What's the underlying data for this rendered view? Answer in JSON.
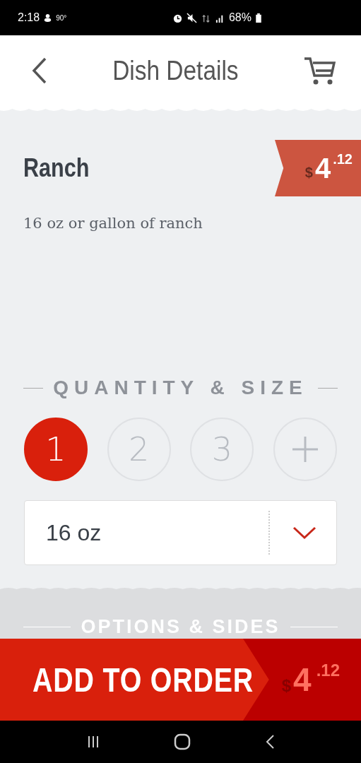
{
  "status_bar": {
    "time": "2:18",
    "temperature": "90°",
    "battery": "68%"
  },
  "header": {
    "title": "Dish Details"
  },
  "dish": {
    "name": "Ranch",
    "description": "16 oz or gallon of ranch",
    "price": {
      "currency": "$",
      "whole": "4",
      "fraction": ".12"
    }
  },
  "quantity_section": {
    "title": "QUANTITY & SIZE",
    "quantities": [
      {
        "label": "1",
        "selected": true
      },
      {
        "label": "2",
        "selected": false
      },
      {
        "label": "3",
        "selected": false
      }
    ],
    "size": {
      "value": "16 oz"
    }
  },
  "options_section": {
    "title": "OPTIONS & SIDES"
  },
  "add_button": {
    "label": "ADD TO ORDER",
    "price": {
      "currency": "$",
      "whole": "4",
      "fraction": ".12"
    }
  }
}
